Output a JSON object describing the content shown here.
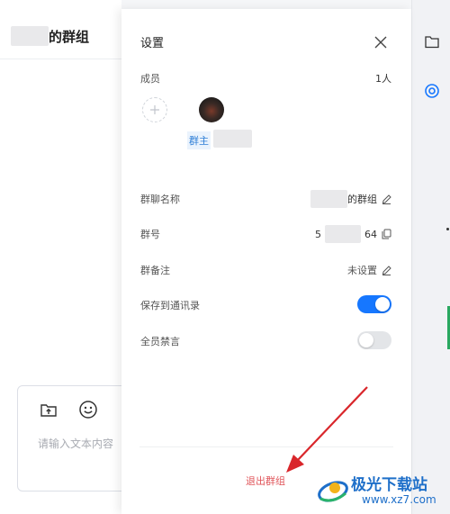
{
  "chat": {
    "title_suffix": "的群组",
    "input_placeholder": "请输入文本内容"
  },
  "panel": {
    "title": "设置",
    "members": {
      "label": "成员",
      "count": "1人",
      "owner_badge": "群主"
    },
    "group_name": {
      "label": "群聊名称",
      "value": "的群组"
    },
    "group_number": {
      "label": "群号",
      "value_start": "5",
      "value_end": "64"
    },
    "group_remark": {
      "label": "群备注",
      "value": "未设置"
    },
    "save_to_contacts": {
      "label": "保存到通讯录",
      "enabled": true
    },
    "mute_all": {
      "label": "全员禁言",
      "enabled": false
    },
    "exit_label": "退出群组"
  },
  "watermark": {
    "name": "极光下载站",
    "url": "www.xz7.com"
  },
  "colors": {
    "accent": "#1677ff",
    "danger": "#e0555a",
    "annotation_arrow": "#d9262b"
  },
  "icons": {
    "upload_file": "folder-upload-icon",
    "emoji": "smile-icon",
    "files": "folder-icon",
    "settings": "settings-icon",
    "close": "close-icon",
    "edit": "pencil-icon",
    "copy": "copy-icon",
    "add": "plus-icon"
  }
}
